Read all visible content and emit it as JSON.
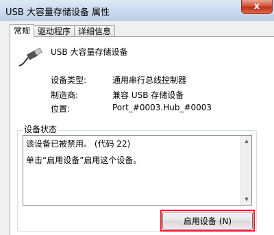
{
  "window": {
    "title": "USB 大容量存储设备 属性",
    "close_glyph": "x"
  },
  "tabs": [
    {
      "label": "常规",
      "active": true
    },
    {
      "label": "驱动程序",
      "active": false
    },
    {
      "label": "详细信息",
      "active": false
    }
  ],
  "device": {
    "name": "USB 大容量存储设备",
    "icon": "usb-plug-icon"
  },
  "properties": [
    {
      "label": "设备类型:",
      "value": "通用串行总线控制器"
    },
    {
      "label": "制造商:",
      "value": "兼容 USB 存储设备"
    },
    {
      "label": "位置:",
      "value": "Port_#0003.Hub_#0003"
    }
  ],
  "status": {
    "group_title": "设备状态",
    "lines": [
      "该设备已被禁用。 (代码 22)",
      "单击“启用设备”启用这个设备。"
    ]
  },
  "actions": {
    "enable_label": "启用设备 (N)",
    "highlight_color": "#e0202a"
  }
}
